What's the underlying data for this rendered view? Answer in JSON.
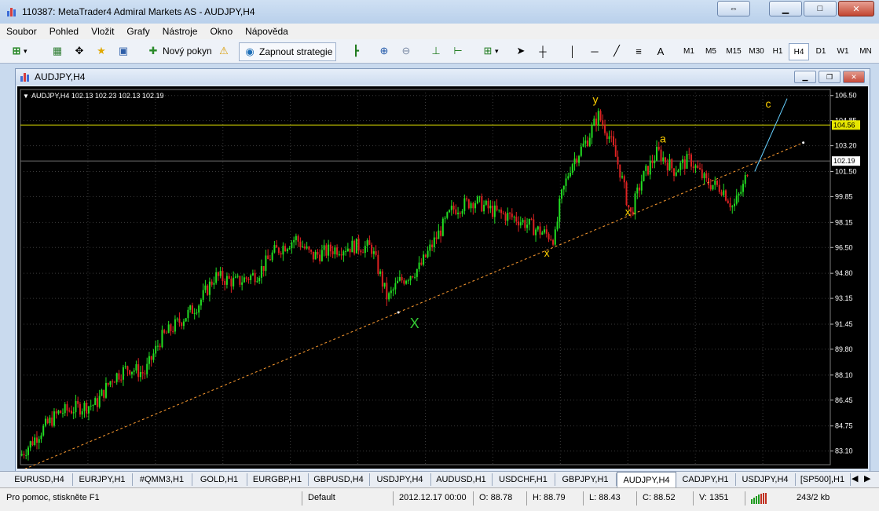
{
  "window": {
    "title": "110387: MetaTrader4 Admiral Markets AS - AUDJPY,H4"
  },
  "menu": [
    "Soubor",
    "Pohled",
    "Vložit",
    "Grafy",
    "Nástroje",
    "Okno",
    "Nápověda"
  ],
  "toolbar": {
    "new_order_label": "Nový pokyn",
    "strategy_label": "Zapnout strategie",
    "text_tool_label": "A",
    "timeframes": [
      "M1",
      "M5",
      "M15",
      "M30",
      "H1",
      "H4",
      "D1",
      "W1",
      "MN"
    ],
    "active_timeframe": "H4"
  },
  "chart_window": {
    "title": "AUDJPY,H4"
  },
  "chart_data": {
    "type": "candlestick",
    "symbol_header": "AUDJPY,H4  102.13 102.23 102.13 102.19",
    "y_ticks": [
      "106.50",
      "104.85",
      "103.20",
      "101.50",
      "99.85",
      "98.15",
      "96.50",
      "94.80",
      "93.15",
      "91.45",
      "89.80",
      "88.10",
      "86.45",
      "84.75",
      "83.10"
    ],
    "ylim": [
      82.2,
      106.9
    ],
    "current_price": "102.19",
    "horizontal_line": "104.56",
    "price_path": [
      [
        0,
        82.8
      ],
      [
        8,
        84.5
      ],
      [
        14,
        85.6
      ],
      [
        20,
        85.9
      ],
      [
        28,
        86.2
      ],
      [
        34,
        87.9
      ],
      [
        40,
        88.6
      ],
      [
        46,
        88.2
      ],
      [
        52,
        90.5
      ],
      [
        60,
        91.8
      ],
      [
        66,
        92.8
      ],
      [
        72,
        94.6
      ],
      [
        80,
        94.2
      ],
      [
        88,
        94.8
      ],
      [
        94,
        96.2
      ],
      [
        102,
        97.1
      ],
      [
        108,
        95.9
      ],
      [
        116,
        96.4
      ],
      [
        124,
        96.6
      ],
      [
        130,
        96.5
      ],
      [
        136,
        93.1
      ],
      [
        140,
        94.2
      ],
      [
        148,
        95.2
      ],
      [
        152,
        96.5
      ],
      [
        160,
        99.0
      ],
      [
        168,
        99.6
      ],
      [
        176,
        98.8
      ],
      [
        184,
        98.4
      ],
      [
        192,
        97.6
      ],
      [
        198,
        97.1
      ],
      [
        200,
        99.6
      ],
      [
        204,
        102.0
      ],
      [
        210,
        103.6
      ],
      [
        214,
        105.2
      ],
      [
        218,
        103.9
      ],
      [
        222,
        101.6
      ],
      [
        226,
        98.6
      ],
      [
        230,
        100.9
      ],
      [
        236,
        102.8
      ],
      [
        242,
        101.6
      ],
      [
        248,
        102.3
      ],
      [
        254,
        100.8
      ],
      [
        260,
        100.4
      ],
      [
        264,
        99.1
      ],
      [
        268,
        100.6
      ],
      [
        270,
        102.2
      ]
    ],
    "trendline": {
      "from": [
        0,
        81.8
      ],
      "to": [
        290,
        103.4
      ]
    },
    "projection_line": {
      "from": [
        272,
        101.5
      ],
      "to": [
        284,
        106.3
      ]
    },
    "wave_labels": [
      {
        "text": "X",
        "x": 146,
        "y": 91.2,
        "color": "#33cc33"
      },
      {
        "text": "x",
        "x": 195,
        "y": 95.9,
        "color": "#ffd000"
      },
      {
        "text": "y",
        "x": 213,
        "y": 106.0,
        "color": "#ffd000"
      },
      {
        "text": "x",
        "x": 225,
        "y": 98.6,
        "color": "#ffd000"
      },
      {
        "text": "a",
        "x": 238,
        "y": 103.4,
        "color": "#ffd000"
      },
      {
        "text": "c",
        "x": 277,
        "y": 105.7,
        "color": "#ffd000"
      }
    ],
    "colors": {
      "background": "#000000",
      "bull": "#22dd22",
      "bear": "#dd2222",
      "grid": "#3a3a3a",
      "trendline": "#ff9c30",
      "level": "#e6e600",
      "projection": "#66d0ff"
    }
  },
  "tabs": [
    "EURUSD,H4",
    "EURJPY,H1",
    "#QMM3,H1",
    "GOLD,H1",
    "EURGBP,H1",
    "GBPUSD,H4",
    "USDJPY,H4",
    "AUDUSD,H1",
    "USDCHF,H1",
    "GBPJPY,H1",
    "AUDJPY,H4",
    "CADJPY,H1",
    "USDJPY,H4",
    "[SP500],H1"
  ],
  "active_tab": "AUDJPY,H4",
  "status": {
    "help": "Pro pomoc, stiskněte F1",
    "profile": "Default",
    "datetime": "2012.12.17 00:00",
    "open": "O: 88.78",
    "high": "H: 88.79",
    "low": "L: 88.43",
    "close": "C: 88.52",
    "volume": "V: 1351",
    "traffic": "243/2 kb"
  }
}
